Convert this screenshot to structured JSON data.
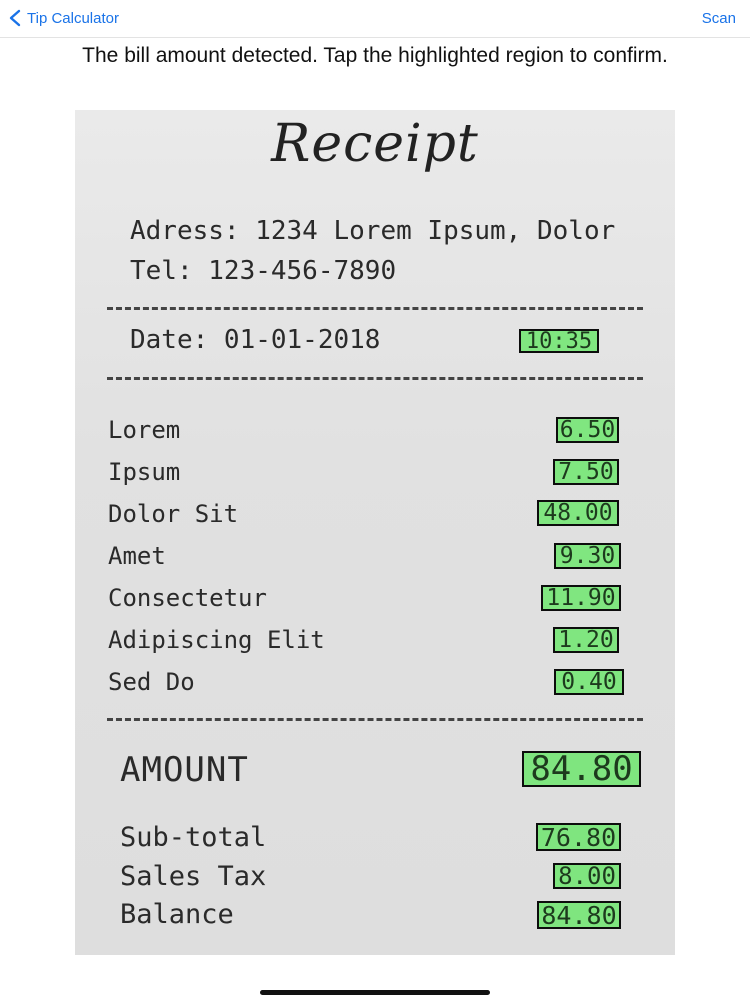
{
  "nav": {
    "back_label": "Tip Calculator",
    "scan_label": "Scan"
  },
  "instruction": "The bill amount detected. Tap the highlighted region to confirm.",
  "receipt": {
    "title": "Receipt",
    "address": "Adress: 1234 Lorem Ipsum, Dolor",
    "tel": "Tel: 123-456-7890",
    "date": "Date: 01-01-2018",
    "time": "10:35",
    "items": [
      {
        "name": "Lorem",
        "price": "6.50"
      },
      {
        "name": "Ipsum",
        "price": "7.50"
      },
      {
        "name": "Dolor Sit",
        "price": "48.00"
      },
      {
        "name": "Amet",
        "price": "9.30"
      },
      {
        "name": "Consectetur",
        "price": "11.90"
      },
      {
        "name": "Adipiscing Elit",
        "price": "1.20"
      },
      {
        "name": "Sed Do",
        "price": "0.40"
      }
    ],
    "amount_label": "AMOUNT",
    "amount_value": "84.80",
    "subtotal_label": "Sub-total",
    "subtotal_value": "76.80",
    "tax_label": "Sales Tax",
    "tax_value": "8.00",
    "balance_label": "Balance",
    "balance_value": "84.80"
  },
  "colors": {
    "accent": "#1a73e8",
    "highlight": "#6ee66e"
  }
}
